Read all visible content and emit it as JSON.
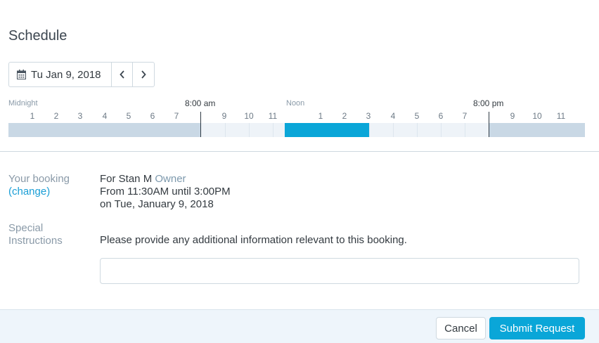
{
  "header": {
    "title": "Schedule"
  },
  "date_picker": {
    "date_label": "Tu Jan 9, 2018"
  },
  "timeline": {
    "labels": {
      "midnight": "Midnight",
      "eight_am": "8:00 am",
      "noon": "Noon",
      "eight_pm": "8:00 pm"
    },
    "hour_numbers": [
      "1",
      "2",
      "3",
      "4",
      "5",
      "6",
      "7",
      "9",
      "10",
      "11",
      "1",
      "2",
      "3",
      "4",
      "5",
      "6",
      "7",
      "9",
      "10",
      "11"
    ],
    "unavailable_ranges": [
      [
        0,
        8
      ],
      [
        20,
        24
      ]
    ],
    "booking_range": [
      11.5,
      15
    ],
    "colors": {
      "unavailable": "#c9d8e5",
      "booking": "#0aa6d8",
      "available": "#eef3f8"
    }
  },
  "booking": {
    "label": "Your booking",
    "change_link": "(change)",
    "for_prefix": "For Stan M",
    "role": "Owner",
    "time_line": "From 11:30AM until 3:00PM",
    "date_line": "on Tue, January 9, 2018"
  },
  "special": {
    "label_line1": "Special",
    "label_line2": "Instructions",
    "prompt": "Please provide any additional information relevant to this booking.",
    "input_value": ""
  },
  "footer": {
    "cancel_label": "Cancel",
    "submit_label": "Submit Request"
  },
  "colors": {
    "accent": "#0aa6d8"
  }
}
